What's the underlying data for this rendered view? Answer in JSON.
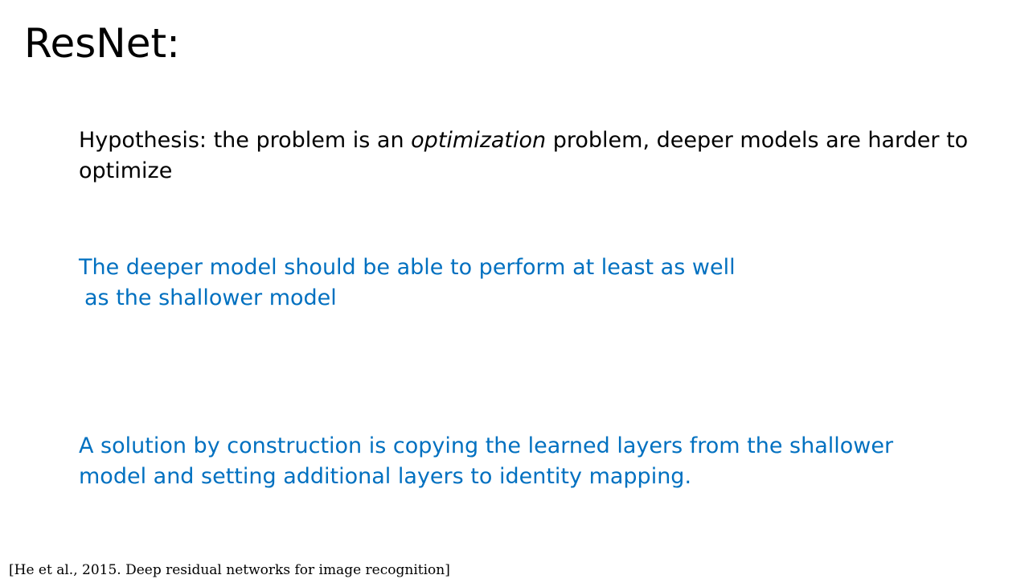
{
  "slide": {
    "title": "ResNet:",
    "hypothesis": {
      "before": "Hypothesis: the problem is an ",
      "emphasis": "optimization",
      "after": " problem, deeper models are harder to",
      "line2": "optimize"
    },
    "claim": {
      "line1": "The deeper model should be able to perform at least as well",
      "line2": "as the shallower model"
    },
    "solution": {
      "line1": "A solution by construction is copying the learned layers from the shallower",
      "line2": "model and setting additional layers to identity mapping."
    },
    "citation": "[He et al., 2015. Deep residual networks for image recognition]"
  },
  "colors": {
    "text": "#000000",
    "accent_blue": "#0070c0",
    "background": "#ffffff"
  }
}
